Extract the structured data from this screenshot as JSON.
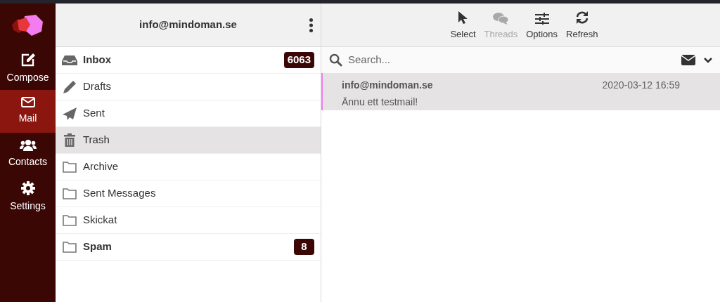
{
  "nav": [
    {
      "kind": "compose",
      "label": "Compose",
      "selected": false
    },
    {
      "kind": "mail",
      "label": "Mail",
      "selected": true
    },
    {
      "kind": "contacts",
      "label": "Contacts",
      "selected": false
    },
    {
      "kind": "settings",
      "label": "Settings",
      "selected": false
    }
  ],
  "account": {
    "title": "info@mindoman.se"
  },
  "folders": [
    {
      "kind": "inbox",
      "label": "Inbox",
      "unread": true,
      "selected": false,
      "count": "6063"
    },
    {
      "kind": "drafts",
      "label": "Drafts",
      "unread": false,
      "selected": false
    },
    {
      "kind": "sent",
      "label": "Sent",
      "unread": false,
      "selected": false
    },
    {
      "kind": "trash",
      "label": "Trash",
      "unread": false,
      "selected": true
    },
    {
      "kind": "folder",
      "label": "Archive",
      "unread": false,
      "selected": false
    },
    {
      "kind": "folder",
      "label": "Sent Messages",
      "unread": false,
      "selected": false
    },
    {
      "kind": "folder",
      "label": "Skickat",
      "unread": false,
      "selected": false
    },
    {
      "kind": "folder",
      "label": "Spam",
      "unread": true,
      "selected": false,
      "count": "8"
    }
  ],
  "toolbar": [
    {
      "kind": "select",
      "label": "Select",
      "disabled": false
    },
    {
      "kind": "threads",
      "label": "Threads",
      "disabled": true
    },
    {
      "kind": "options",
      "label": "Options",
      "disabled": false
    },
    {
      "kind": "refresh",
      "label": "Refresh",
      "disabled": false
    }
  ],
  "search": {
    "placeholder": "Search..."
  },
  "messages": [
    {
      "from": "info@mindoman.se",
      "date": "2020-03-12 16:59",
      "subject": "Ännu ett testmail!",
      "selected": true
    }
  ]
}
